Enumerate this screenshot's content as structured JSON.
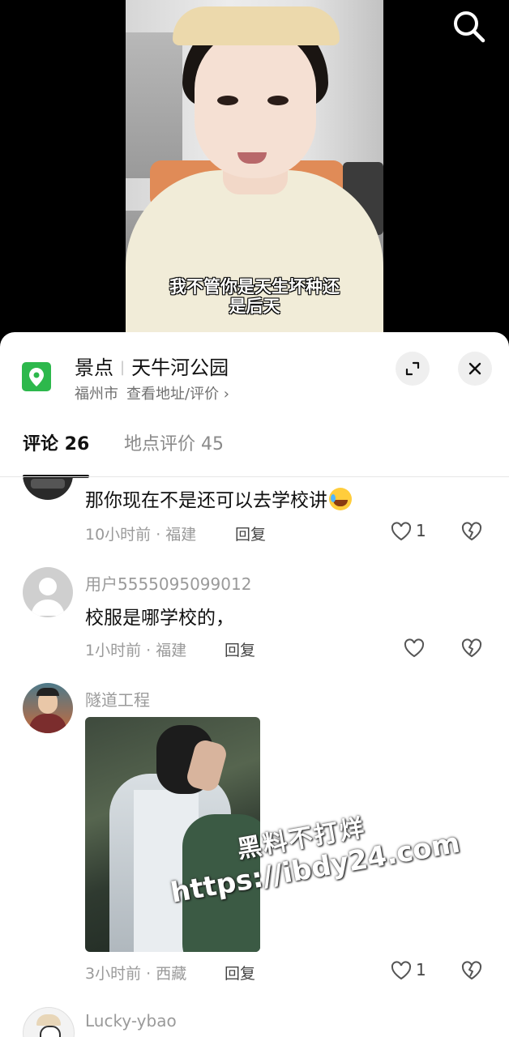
{
  "video": {
    "subtitle_line1": "我不管你是天生坏种还",
    "subtitle_line2": "是后天"
  },
  "icons": {
    "search": "search-icon",
    "location": "map-pin-icon",
    "expand": "expand-icon",
    "close": "close-icon",
    "like": "heart-icon",
    "dislike": "broken-heart-icon"
  },
  "colors": {
    "location_green": "#2db84c",
    "sheet_bg": "#ffffff",
    "muted_text": "#9a9a9a"
  },
  "location": {
    "category": "景点",
    "name": "天牛河公园",
    "city": "福州市",
    "link": "查看地址/评价 ›"
  },
  "tabs": [
    {
      "label": "评论 26",
      "active": true
    },
    {
      "label": "地点评价 45",
      "active": false
    }
  ],
  "comments": [
    {
      "user": "",
      "text": "那你现在不是还可以去学校讲",
      "emoji": "rolling-laughing-emoji",
      "meta": "10小时前 · 福建",
      "reply": "回复",
      "likes": "1"
    },
    {
      "user": "用户5555095099012",
      "text": "校服是哪学校的，",
      "meta": "1小时前 · 福建",
      "reply": "回复",
      "likes": ""
    },
    {
      "user": "隧道工程",
      "text": "",
      "has_image": true,
      "meta": "3小时前 · 西藏",
      "reply": "回复",
      "likes": "1"
    },
    {
      "user": "Lucky-ybao"
    }
  ],
  "watermark": {
    "line1": "黑料不打烊",
    "line2": "https://ibdy24.com"
  }
}
